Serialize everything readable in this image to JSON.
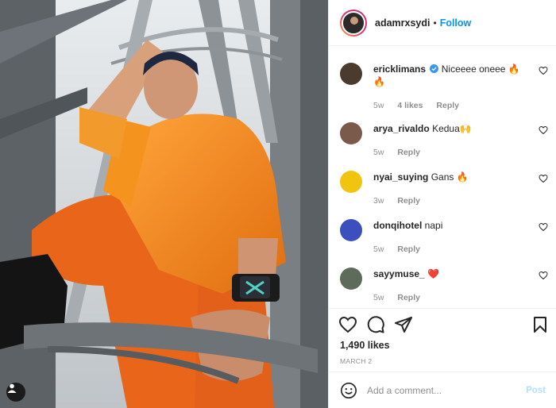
{
  "post": {
    "username": "adamrxsydi",
    "separator": "•",
    "follow_label": "Follow"
  },
  "comments": [
    {
      "username": "ericklimans",
      "verified": true,
      "text": "Niceeee oneee 🔥 🔥",
      "time": "5w",
      "likes": "4 likes",
      "reply": "Reply"
    },
    {
      "username": "arya_rivaldo",
      "verified": false,
      "text": "Kedua🙌",
      "time": "5w",
      "likes": "",
      "reply": "Reply"
    },
    {
      "username": "nyai_suying",
      "verified": false,
      "text": "Gans 🔥",
      "time": "3w",
      "likes": "",
      "reply": "Reply"
    },
    {
      "username": "donqihotel",
      "verified": false,
      "text": "napi",
      "time": "5w",
      "likes": "",
      "reply": "Reply"
    },
    {
      "username": "sayymuse_",
      "verified": false,
      "text": "❤️",
      "time": "5w",
      "likes": "",
      "reply": "Reply"
    }
  ],
  "stats": {
    "likes": "1,490 likes",
    "date": "MARCH 2"
  },
  "add_comment": {
    "placeholder": "Add a comment...",
    "post_label": "Post"
  },
  "icons": {
    "like": "heart-icon",
    "comment": "comment-icon",
    "share": "paper-plane-icon",
    "save": "bookmark-icon",
    "emoji": "smiley-icon",
    "tag": "person-tag-icon"
  },
  "colors": {
    "link": "#0095f6",
    "muted": "#8e8e8e",
    "post_disabled": "#b2dffc",
    "jacket": "#f08a1e"
  }
}
